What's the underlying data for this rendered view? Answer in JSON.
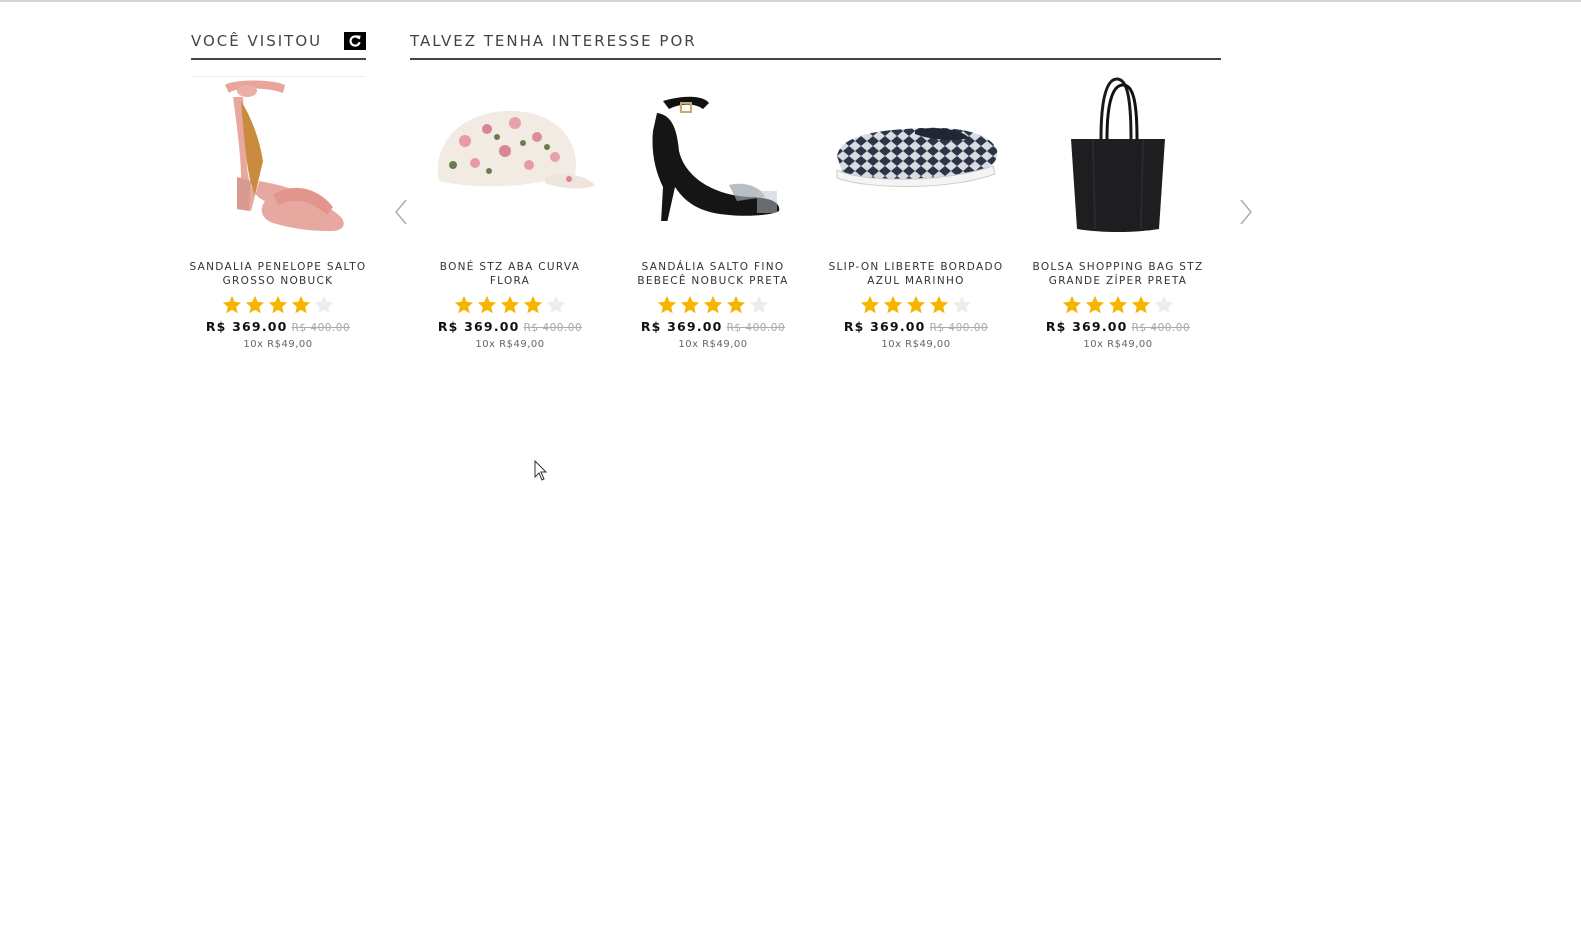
{
  "visited": {
    "title": "VOCÊ VISITOU",
    "refresh_icon": "refresh-icon",
    "product": {
      "name": "SANDALIA PENELOPE SALTO GROSSO NOBUCK",
      "rating": 4,
      "rating_max": 5,
      "price": "R$ 369.00",
      "old_price": "R$ 400.00",
      "installments": "10x R$49,00"
    }
  },
  "interest": {
    "title": "TALVEZ TENHA INTERESSE POR",
    "prev_icon": "chevron-left-icon",
    "next_icon": "chevron-right-icon",
    "products": [
      {
        "name": "BONÉ STZ ABA CURVA FLORA",
        "rating": 4,
        "rating_max": 5,
        "price": "R$ 369.00",
        "old_price": "R$ 400.00",
        "installments": "10x R$49,00"
      },
      {
        "name": "SANDÁLIA SALTO FINO BEBECÊ NOBUCK PRETA",
        "rating": 4,
        "rating_max": 5,
        "price": "R$ 369.00",
        "old_price": "R$ 400.00",
        "installments": "10x R$49,00"
      },
      {
        "name": "SLIP-ON LIBERTE BORDADO AZUL MARINHO",
        "rating": 4,
        "rating_max": 5,
        "price": "R$ 369.00",
        "old_price": "R$ 400.00",
        "installments": "10x R$49,00"
      },
      {
        "name": "BOLSA SHOPPING BAG STZ GRANDE ZÍPER PRETA",
        "rating": 4,
        "rating_max": 5,
        "price": "R$ 369.00",
        "old_price": "R$ 400.00",
        "installments": "10x R$49,00"
      }
    ]
  },
  "colors": {
    "star_filled": "#f7b500",
    "star_empty": "#ececec"
  }
}
